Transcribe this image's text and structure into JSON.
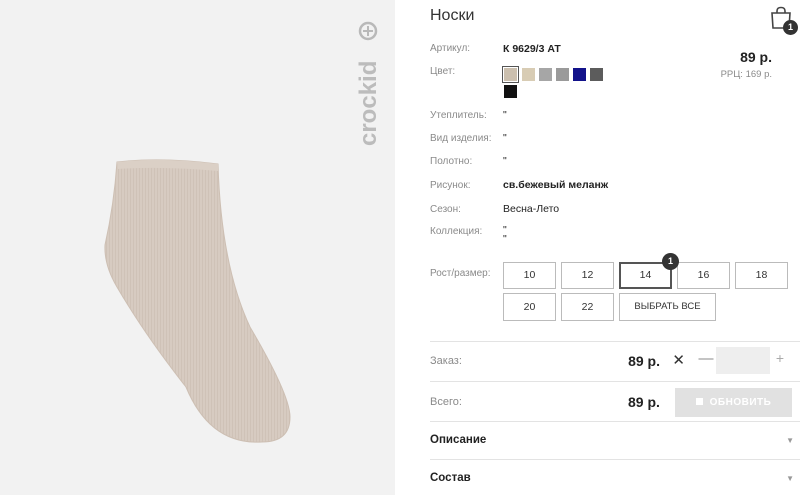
{
  "product": {
    "title": "Носки",
    "brand": "crockid",
    "cart_count": "1"
  },
  "specs": {
    "article_label": "Артикул:",
    "article_value": "К 9629/3 АТ",
    "color_label": "Цвет:",
    "insulation_label": "Утеплитель:",
    "insulation_value": "\"",
    "item_type_label": "Вид изделия:",
    "item_type_value": "\"",
    "fabric_label": "Полотно:",
    "fabric_value": "\"",
    "pattern_label": "Рисунок:",
    "pattern_value": "св.бежевый меланж",
    "season_label": "Сезон:",
    "season_value": "Весна-Лето",
    "collection_label": "Коллекция:",
    "collection_value_1": "\"",
    "collection_value_2": "\""
  },
  "pricing": {
    "price": "89 р.",
    "rrp": "РРЦ: 169 р."
  },
  "colors": {
    "swatches": [
      "#cbbfae",
      "#d8ccb4",
      "#a6a6a6",
      "#9a9a9a",
      "#12128a",
      "#5c5c5c",
      "#111111"
    ],
    "selected_index": 0
  },
  "sizes": {
    "label": "Рост/размер:",
    "options": [
      "10",
      "12",
      "14",
      "16",
      "18",
      "20",
      "22"
    ],
    "selected": "14",
    "selected_badge": "1",
    "select_all": "ВЫБРАТЬ ВСЕ"
  },
  "order": {
    "label": "Заказ:",
    "price": "89 р.",
    "remove": "✕",
    "minus": "—",
    "plus": "+",
    "quantity": ""
  },
  "total": {
    "label": "Всего:",
    "price": "89 р.",
    "update": "ОБНОВИТЬ"
  },
  "accordion": {
    "description": "Описание",
    "composition": "Состав",
    "arrow": "▼"
  }
}
